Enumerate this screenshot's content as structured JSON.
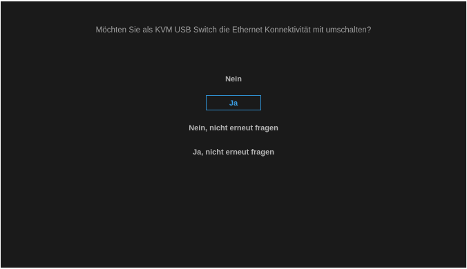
{
  "dialog": {
    "question": "Möchten Sie als KVM USB Switch die Ethernet Konnektivität mit umschalten?",
    "options": [
      {
        "label": "Nein",
        "selected": false
      },
      {
        "label": "Ja",
        "selected": true
      },
      {
        "label": "Nein, nicht erneut fragen",
        "selected": false
      },
      {
        "label": "Ja, nicht erneut fragen",
        "selected": false
      }
    ]
  },
  "colors": {
    "background": "#1a1a1a",
    "text": "#b4b4b4",
    "highlight": "#2f8fcf"
  }
}
